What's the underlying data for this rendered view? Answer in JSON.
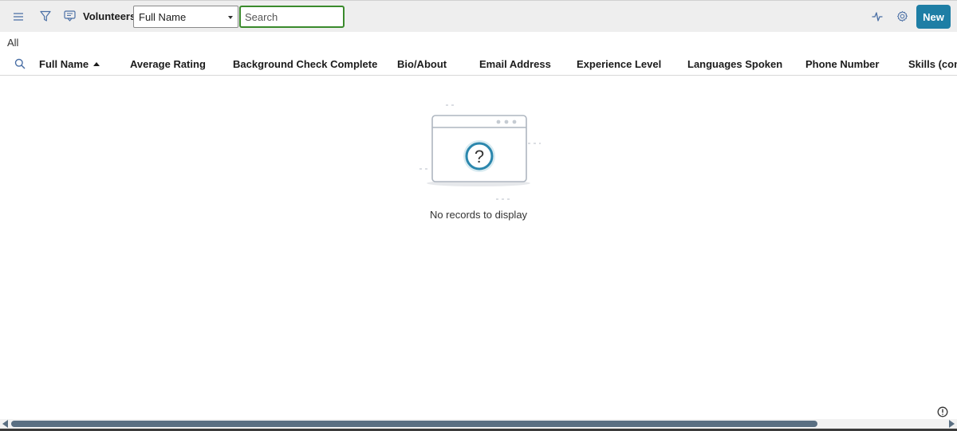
{
  "toolbar": {
    "icons": [
      "menu-icon",
      "filter-icon",
      "form-icon",
      "pulse-icon",
      "gear-icon"
    ],
    "title": "Volunteers",
    "field_select": {
      "selected": "Full Name"
    },
    "search": {
      "placeholder": "Search",
      "value": ""
    },
    "new_label": "New",
    "accent_color": "#1e7ea5",
    "search_focus_color": "#3a8a2c"
  },
  "view": {
    "label": "All"
  },
  "table": {
    "columns": [
      {
        "label": "Full Name",
        "sorted": "ascending"
      },
      {
        "label": "Average Rating"
      },
      {
        "label": "Background Check Complete"
      },
      {
        "label": "Bio/About"
      },
      {
        "label": "Email Address"
      },
      {
        "label": "Experience Level"
      },
      {
        "label": "Languages Spoken"
      },
      {
        "label": "Phone Number"
      },
      {
        "label": "Skills (comm"
      }
    ],
    "rows": []
  },
  "empty_state": {
    "icon": "question-window-illustration",
    "message": "No records to display"
  },
  "footer": {
    "icons": [
      "info-icon"
    ]
  }
}
